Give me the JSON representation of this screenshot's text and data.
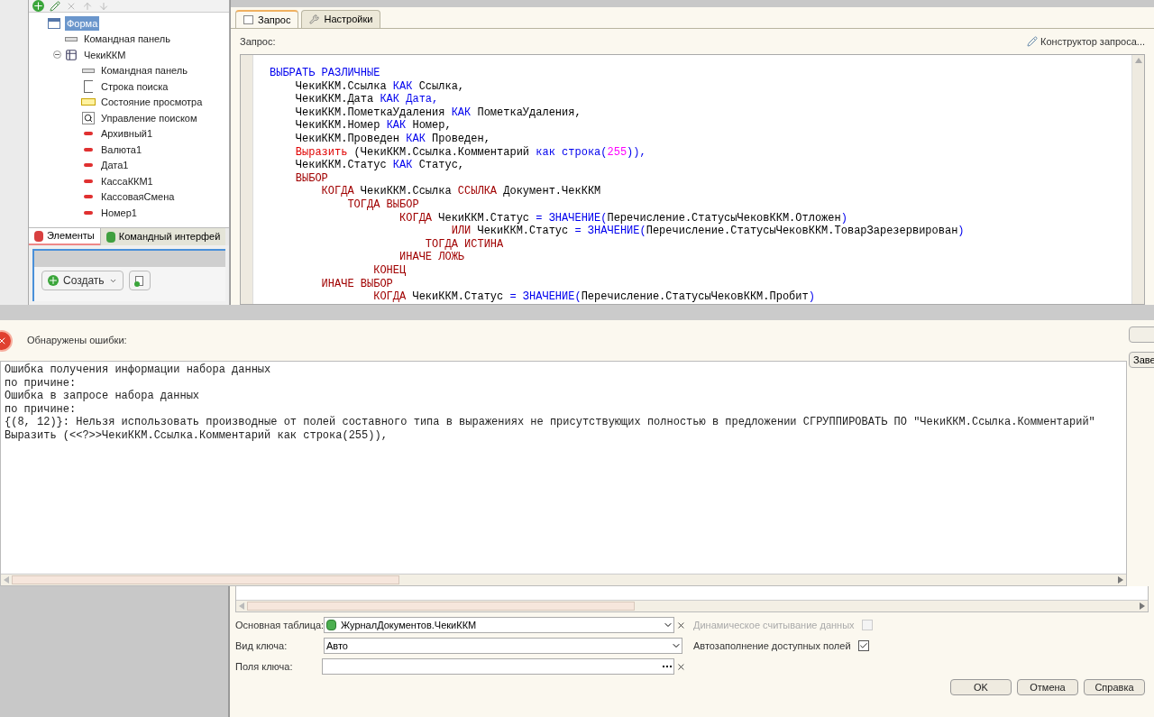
{
  "tree": [
    {
      "label": "Форма",
      "kind": "form",
      "selected": true,
      "children": [
        {
          "label": "Командная панель",
          "kind": "command-bar",
          "selected": false
        },
        {
          "label": "ЧекиККМ",
          "kind": "table",
          "selected": false,
          "expanded": true,
          "children": [
            {
              "label": "Командная панель",
              "kind": "command-bar",
              "selected": false
            },
            {
              "label": "Строка поиска",
              "kind": "search-string",
              "selected": false
            },
            {
              "label": "Состояние просмотра",
              "kind": "view-state",
              "selected": false
            },
            {
              "label": "Управление поиском",
              "kind": "search-control",
              "selected": false
            },
            {
              "label": "Архивный1",
              "kind": "field",
              "selected": false
            },
            {
              "label": "Валюта1",
              "kind": "field",
              "selected": false
            },
            {
              "label": "Дата1",
              "kind": "field",
              "selected": false
            },
            {
              "label": "КассаККМ1",
              "kind": "field",
              "selected": false
            },
            {
              "label": "КассоваяСмена",
              "kind": "field",
              "selected": false
            },
            {
              "label": "Номер1",
              "kind": "field",
              "selected": false
            }
          ]
        }
      ]
    }
  ],
  "left_tabs": [
    {
      "label": "Элементы",
      "selected": true
    },
    {
      "label": "Командный интерфей",
      "selected": false
    }
  ],
  "create_button": "Создать",
  "dialog": {
    "tabs": [
      {
        "label": "Запрос",
        "selected": true
      },
      {
        "label": "Настройки",
        "selected": false
      }
    ],
    "query_label": "Запрос:",
    "constructor_link": "Конструктор запроса...",
    "code": [
      [
        {
          "kind": "kw",
          "text": "ВЫБРАТЬ РАЗЛИЧНЫЕ"
        }
      ],
      [
        {
          "kind": "plain",
          "text": "    ЧекиККМ.Ссылка "
        },
        {
          "kind": "kw",
          "text": "КАК"
        },
        {
          "kind": "plain",
          "text": " Ссылка,"
        }
      ],
      [
        {
          "kind": "plain",
          "text": "    ЧекиККМ.Дата "
        },
        {
          "kind": "kw",
          "text": "КАК Дата,"
        }
      ],
      [
        {
          "kind": "plain",
          "text": "    ЧекиККМ.ПометкаУдаления "
        },
        {
          "kind": "kw",
          "text": "КАК"
        },
        {
          "kind": "plain",
          "text": " ПометкаУдаления,"
        }
      ],
      [
        {
          "kind": "plain",
          "text": "    ЧекиККМ.Номер "
        },
        {
          "kind": "kw",
          "text": "КАК"
        },
        {
          "kind": "plain",
          "text": " Номер,"
        }
      ],
      [
        {
          "kind": "plain",
          "text": "    ЧекиККМ.Проведен "
        },
        {
          "kind": "kw",
          "text": "КАК"
        },
        {
          "kind": "plain",
          "text": " Проведен,"
        }
      ],
      [
        {
          "kind": "fn",
          "text": "    Выразить"
        },
        {
          "kind": "plain",
          "text": " (ЧекиККМ.Ссылка.Комментарий "
        },
        {
          "kind": "kw",
          "text": "как строка("
        },
        {
          "kind": "num",
          "text": "255"
        },
        {
          "kind": "kw",
          "text": ")),"
        }
      ],
      [
        {
          "kind": "plain",
          "text": "    ЧекиККМ.Статус "
        },
        {
          "kind": "kw",
          "text": "КАК"
        },
        {
          "kind": "plain",
          "text": " Статус,"
        }
      ],
      [
        {
          "kind": "red",
          "text": "    ВЫБОР"
        }
      ],
      [
        {
          "kind": "red",
          "text": "        КОГДА"
        },
        {
          "kind": "plain",
          "text": " ЧекиККМ.Ссылка "
        },
        {
          "kind": "red",
          "text": "ССЫЛКА"
        },
        {
          "kind": "plain",
          "text": " Документ.ЧекККМ"
        }
      ],
      [
        {
          "kind": "red",
          "text": "            ТОГДА ВЫБОР"
        }
      ],
      [
        {
          "kind": "red",
          "text": "                    КОГДА"
        },
        {
          "kind": "plain",
          "text": " ЧекиККМ.Статус "
        },
        {
          "kind": "kw",
          "text": "= ЗНАЧЕНИЕ("
        },
        {
          "kind": "plain",
          "text": "Перечисление.СтатусыЧековККМ.Отложен"
        },
        {
          "kind": "kw",
          "text": ")"
        }
      ],
      [
        {
          "kind": "red",
          "text": "                            ИЛИ"
        },
        {
          "kind": "plain",
          "text": " ЧекиККМ.Статус "
        },
        {
          "kind": "kw",
          "text": "= ЗНАЧЕНИЕ("
        },
        {
          "kind": "plain",
          "text": "Перечисление.СтатусыЧековККМ.ТоварЗарезервирован"
        },
        {
          "kind": "kw",
          "text": ")"
        }
      ],
      [
        {
          "kind": "red",
          "text": "                        ТОГДА ИСТИНА"
        }
      ],
      [
        {
          "kind": "red",
          "text": "                    ИНАЧЕ ЛОЖЬ"
        }
      ],
      [
        {
          "kind": "red",
          "text": "                КОНЕЦ"
        }
      ],
      [
        {
          "kind": "red",
          "text": "        ИНАЧЕ ВЫБОР"
        }
      ],
      [
        {
          "kind": "red",
          "text": "                КОГДА"
        },
        {
          "kind": "plain",
          "text": " ЧекиККМ.Статус "
        },
        {
          "kind": "kw",
          "text": "= ЗНАЧЕНИЕ("
        },
        {
          "kind": "plain",
          "text": "Перечисление.СтатусыЧековККМ.Пробит"
        },
        {
          "kind": "kw",
          "text": ")"
        }
      ]
    ]
  },
  "error": {
    "header": "Обнаружены ошибки:",
    "lines": [
      "Ошибка получения информации набора данных",
      "по причине:",
      "Ошибка в запросе набора данных",
      "по причине:",
      "{(8, 12)}: Нельзя использовать производные от полей составного типа в выражениях не присутствующих полностью в предложении СГРУППИРОВАТЬ ПО \"ЧекиККМ.Ссылка.Комментарий\"",
      "Выразить (<<?>>ЧекиККМ.Ссылка.Комментарий как строка(255)),"
    ],
    "side_button": "Заве"
  },
  "settings": {
    "fields": [
      {
        "label": "Основная таблица:",
        "value": "ЖурналДокументов.ЧекиККМ",
        "kind": "table-select"
      },
      {
        "label": "Вид ключа:",
        "value": "Авто",
        "kind": "select"
      },
      {
        "label": "Поля ключа:",
        "kind": "list"
      }
    ],
    "options": [
      {
        "label": "Динамическое считывание данных",
        "checked": false,
        "disabled": true
      },
      {
        "label": "Автозаполнение доступных полей",
        "checked": true,
        "disabled": false
      }
    ],
    "buttons": [
      "OK",
      "Отмена",
      "Справка"
    ]
  }
}
